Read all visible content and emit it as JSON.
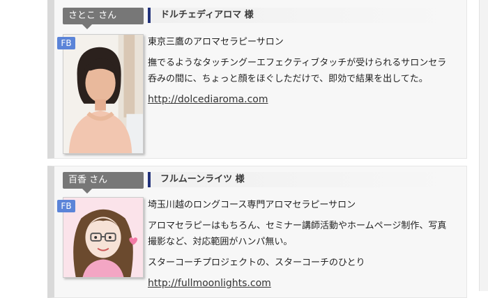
{
  "profiles": [
    {
      "name_tag": "さとこ さん",
      "fb_badge": "FB",
      "salon_name": "ドルチェディアロマ 様",
      "tagline": "東京三鷹のアロマセラピーサロン",
      "description": "撫でるようなタッチングーエフェクティブタッチが受けられるサロンセラ呑みの間に、ちょっと顔をほぐしただけで、即効で結果を出してた。",
      "extra": "",
      "link": "http://dolcediaroma.com"
    },
    {
      "name_tag": "百香 さん",
      "fb_badge": "FB",
      "salon_name": "フルムーンライツ 様",
      "tagline": "埼玉川越のロングコース専門アロマセラピーサロン",
      "description": "アロマセラピーはもちろん、セミナー講師活動やホームページ制作、写真撮影など、対応範囲がハンパ無い。",
      "extra": "スターコーチプロジェクトの、スターコーチのひとり",
      "link": "http://fullmoonlights.com"
    }
  ],
  "colors": {
    "name_tag_bg": "#777777",
    "fb_badge_bg": "#5b84d8",
    "salon_accent": "#22327a",
    "card_bg": "#f7f7f7"
  }
}
